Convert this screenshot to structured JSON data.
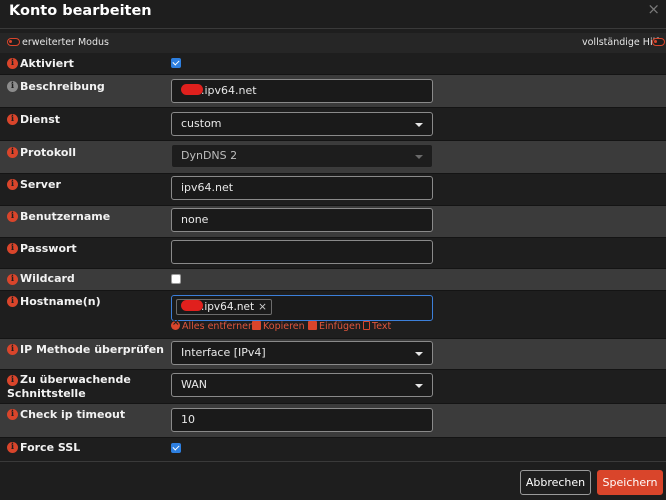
{
  "dialog": {
    "title": "Konto bearbeiten",
    "close_label": "×"
  },
  "mode_bar": {
    "advanced_label": "erweiterter Modus",
    "help_label": "vollständige Hilfe"
  },
  "fields": {
    "enabled": {
      "label": "Aktiviert",
      "checked": true
    },
    "description": {
      "label": "Beschreibung",
      "value_suffix": ".ipv64.net"
    },
    "service": {
      "label": "Dienst",
      "value": "custom"
    },
    "protocol": {
      "label": "Protokoll",
      "value": "DynDNS 2"
    },
    "server": {
      "label": "Server",
      "value": "ipv64.net"
    },
    "username": {
      "label": "Benutzername",
      "value": "none"
    },
    "password": {
      "label": "Passwort",
      "value": ""
    },
    "wildcard": {
      "label": "Wildcard",
      "checked": false
    },
    "hostnames": {
      "label": "Hostname(n)",
      "tag_suffix": ".ipv64.net",
      "tag_remove": "×",
      "actions": {
        "clear_all": "Alles entfernen",
        "copy": "Kopieren",
        "paste": "Einfügen",
        "text": "Text"
      }
    },
    "ip_check_method": {
      "label": "IP Methode überprüfen",
      "value": "Interface [IPv4]"
    },
    "monitored_interface": {
      "label_line1": "Zu überwachende",
      "label_line2": "Schnittstelle",
      "value": "WAN"
    },
    "check_ip_timeout": {
      "label": "Check ip timeout",
      "value": "10"
    },
    "force_ssl": {
      "label": "Force SSL",
      "checked": true
    }
  },
  "buttons": {
    "cancel": "Abbrechen",
    "save": "Speichern"
  },
  "colors": {
    "accent": "#d9452b",
    "checkbox_checked": "#2d7fe0",
    "focus_border": "#3c7fd9"
  },
  "icons": {
    "info": "i"
  }
}
